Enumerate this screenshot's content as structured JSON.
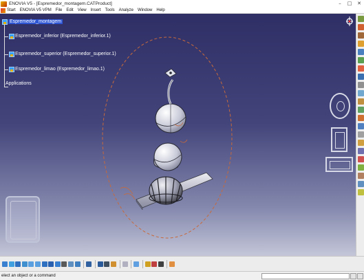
{
  "window": {
    "title": "ENOVIA V5 - [Espremedor_montagem.CATProduct]",
    "controls": [
      "minimize",
      "maximize",
      "close"
    ]
  },
  "menubar": {
    "items": [
      "Start",
      "ENOVIA V5 VPM",
      "File",
      "Edit",
      "View",
      "Insert",
      "Tools",
      "Analyze",
      "Window",
      "Help"
    ]
  },
  "tree": {
    "root": "Espremedor_montagem",
    "items": [
      "Espremedor_inferior (Espremedor_inferior.1)",
      "Espremedor_superior (Espremedor_superior.1)",
      "Espremedor_limao (Espremedor_limao.1)"
    ],
    "applications": "Applications"
  },
  "statusbar": {
    "message": "elect an object or a command",
    "command_value": ""
  },
  "icons": {
    "compass": "compass-icon",
    "tree_node": "product-node-icon",
    "zoom": "zoom-icon",
    "pan": "pan-icon",
    "rotate": "rotate-icon",
    "fit_all": "fit-all-icon",
    "normal_view": "normal-view-icon"
  },
  "colors": {
    "viewport_top": "#2f2f66",
    "viewport_bottom": "#c4c6d8",
    "tree_selection": "#2d55d4",
    "trajectory": "#c86a3c",
    "toolbar_bg": "#ececec"
  }
}
